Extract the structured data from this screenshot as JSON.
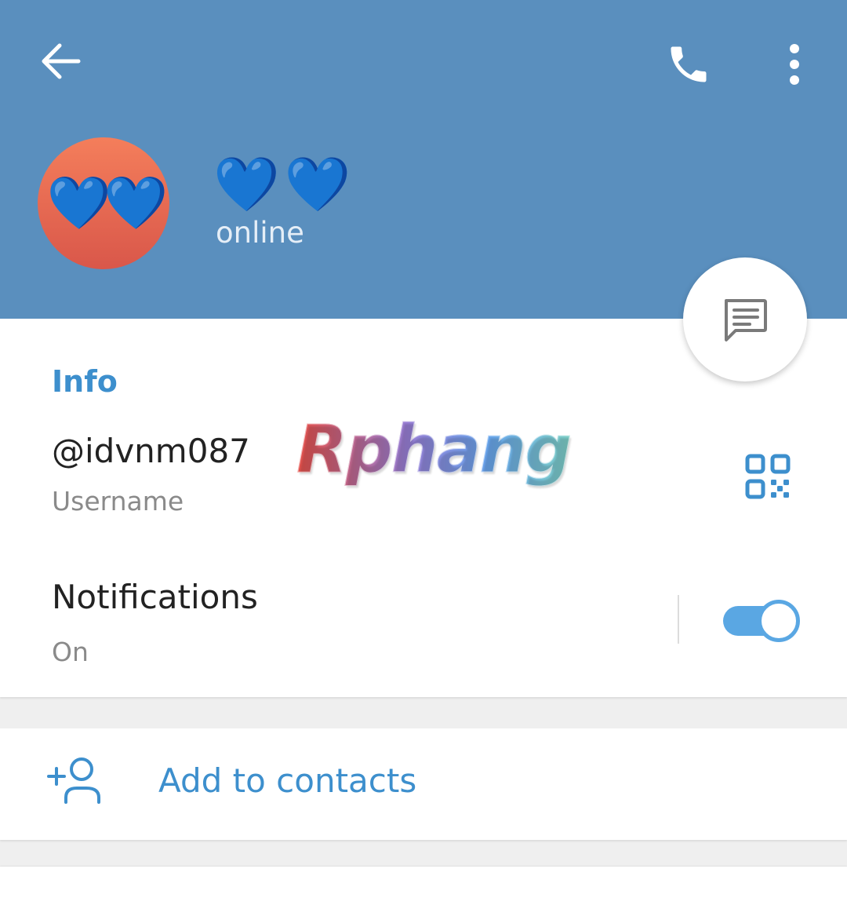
{
  "header": {
    "title": "💙💙",
    "avatar_emoji": "💙💙",
    "status": "online",
    "background_color": "#5a8fbe"
  },
  "toolbar": {
    "back_icon": "arrow-left-icon",
    "call_icon": "phone-icon",
    "menu_icon": "more-vert-icon"
  },
  "fab": {
    "icon": "message-icon"
  },
  "info": {
    "section_title": "Info",
    "username_value": "@idvnm087",
    "username_label": "Username",
    "qr_icon": "qr-code-icon"
  },
  "notifications": {
    "title": "Notifications",
    "value": "On",
    "enabled": true
  },
  "actions": {
    "add_to_contacts": "Add to contacts",
    "add_icon": "add-person-icon"
  },
  "watermark": {
    "text": "Rphang"
  },
  "colors": {
    "accent": "#3d8fcd",
    "toggle_on": "#5aa7e3",
    "avatar": "#e8684f"
  }
}
